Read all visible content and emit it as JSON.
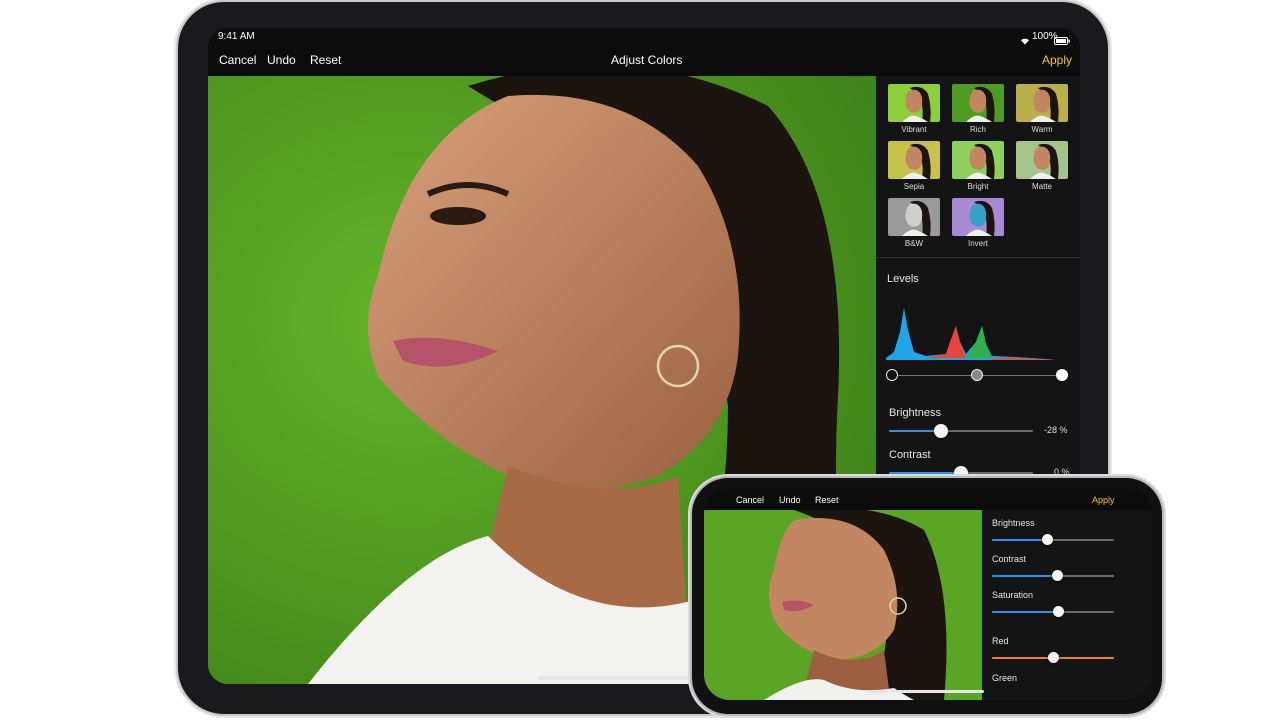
{
  "ipad": {
    "status": {
      "time": "9:41 AM",
      "battery": "100%"
    },
    "nav": {
      "cancel": "Cancel",
      "undo": "Undo",
      "reset": "Reset",
      "title": "Adjust Colors",
      "apply": "Apply"
    },
    "presets": [
      {
        "label": "Vibrant",
        "tint": "#8ccf3a",
        "selected": true
      },
      {
        "label": "Rich",
        "tint": "#4e9c24"
      },
      {
        "label": "Warm",
        "tint": "#b9b04a"
      },
      {
        "label": "Sepia",
        "tint": "#c8c14a"
      },
      {
        "label": "Bright",
        "tint": "#8fd05a"
      },
      {
        "label": "Matte",
        "tint": "#a3c48a"
      },
      {
        "label": "B&W",
        "tint": "#9a9a9a"
      },
      {
        "label": "Invert",
        "tint": "#a98ad6"
      }
    ],
    "levels": {
      "label": "Levels"
    },
    "brightness": {
      "label": "Brightness",
      "value": "-28 %",
      "level": 0.36
    },
    "contrast": {
      "label": "Contrast",
      "value": "0 %",
      "level": 0.5
    }
  },
  "iphone": {
    "nav": {
      "cancel": "Cancel",
      "undo": "Undo",
      "reset": "Reset",
      "apply": "Apply"
    },
    "sliders": [
      {
        "label": "Brightness",
        "level": 0.45,
        "color": "#2d8ff0"
      },
      {
        "label": "Contrast",
        "level": 0.53,
        "color": "#2d8ff0"
      },
      {
        "label": "Saturation",
        "level": 0.54,
        "color": "#2d8ff0"
      },
      {
        "label": "Red",
        "level": 0.5,
        "color": "#f07a2d"
      }
    ],
    "green": {
      "label": "Green"
    }
  },
  "colors": {
    "accent": "#f7c52a",
    "slider": "#2d8ff0",
    "backdrop": "#5aa524"
  }
}
